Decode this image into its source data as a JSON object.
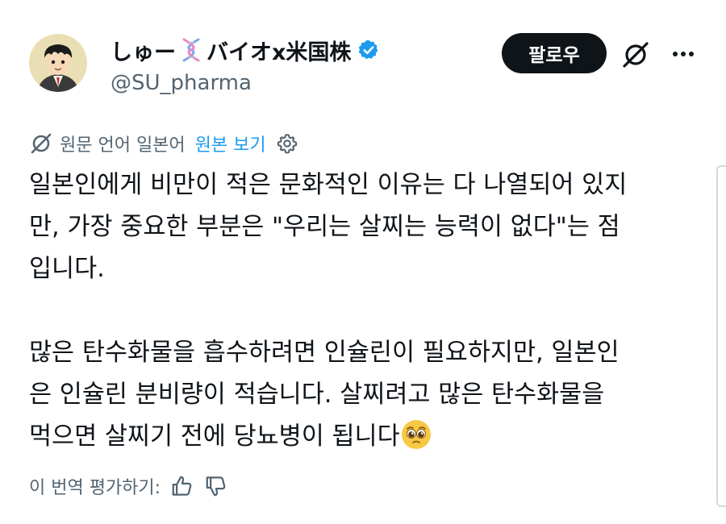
{
  "user": {
    "display_name_part1": "しゅー",
    "display_name_emoji": "dna-emoji",
    "display_name_part2": "バイオx米国株",
    "handle": "@SU_pharma",
    "verified_icon": "verified-badge-icon",
    "avatar": "cartoon-avatar"
  },
  "actions": {
    "follow_label": "팔로우",
    "grok_icon": "grok-icon",
    "more_icon": "more-icon"
  },
  "translation": {
    "notice": "원문 언어 일본어",
    "show_original": "원본 보기",
    "settings_icon": "gear-icon"
  },
  "body": {
    "paragraphs": [
      {
        "lines": [
          "일본인에게 비만이 적은 문화적인 이유는 다 나열되어 있지",
          "만, 가장 중요한 부분은 \"우리는 살찌는 능력이 없다\"는 점",
          "입니다."
        ]
      },
      {
        "lines": [
          "많은 탄수화물을 흡수하려면 인슐린이 필요하지만, 일본인",
          "은 인슐린 분비량이 적습니다. 살찌려고 많은 탄수화물을",
          "먹으면 살찌기 전에 당뇨병이 됩니다"
        ],
        "trailing_emoji": "pleading-face-emoji"
      }
    ]
  },
  "rating": {
    "label": "이 번역 평가하기:",
    "thumbs_up_icon": "thumbs-up-icon",
    "thumbs_down_icon": "thumbs-down-icon"
  },
  "colors": {
    "text": "#0f1419",
    "secondary": "#536471",
    "link": "#1d9bf0",
    "follow_bg": "#0f1419",
    "verified": "#1d9bf0"
  }
}
